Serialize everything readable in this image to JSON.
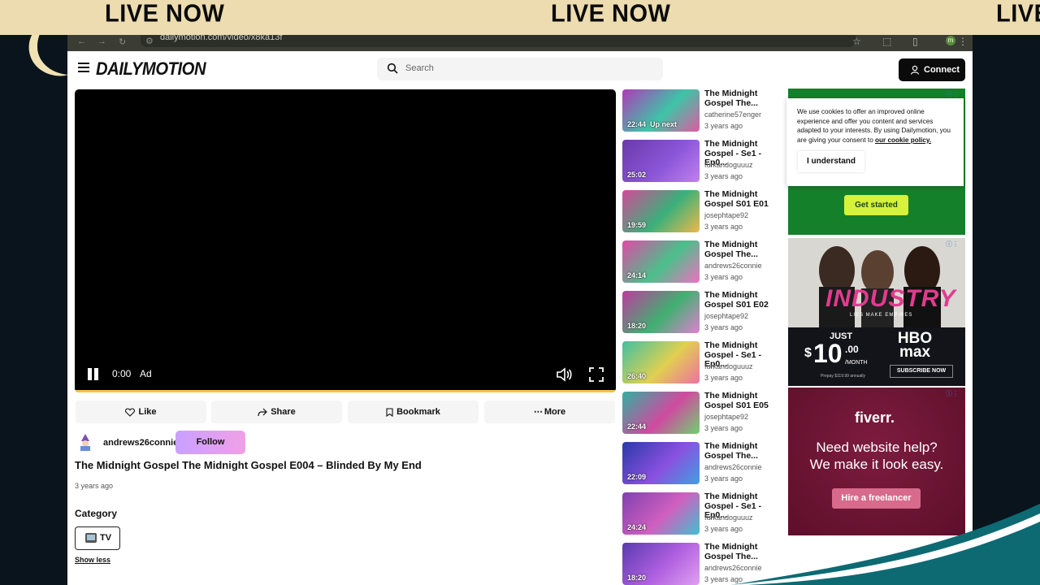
{
  "banner": {
    "text_1": "LIVE NOW",
    "text_2": "LIVE NOW",
    "text_3": "LIVE"
  },
  "browser": {
    "url": "dailymotion.com/video/x8ka13f",
    "profile_initial": "m"
  },
  "header": {
    "logo": "DAILYMOTION",
    "search_placeholder": "Search",
    "connect_label": "Connect"
  },
  "player": {
    "time": "0:00",
    "ad_label": "Ad",
    "progress": 1.0
  },
  "actions": {
    "like": "Like",
    "share": "Share",
    "bookmark": "Bookmark",
    "more": "More"
  },
  "channel": {
    "name": "andrews26connie",
    "follow_label": "Follow"
  },
  "video": {
    "title": "The Midnight Gospel The Midnight Gospel E004 – Blinded By My End",
    "date": "3 years ago",
    "category_heading": "Category",
    "category": "TV",
    "show_less": "Show less"
  },
  "related": [
    {
      "title": "The Midnight Gospel The...",
      "channel": "catherine57enger",
      "date": "3 years ago",
      "duration": "22:44",
      "badge": "Up next",
      "colors": [
        "#b03ab8",
        "#3ec4a8",
        "#e05aa0"
      ]
    },
    {
      "title": "The Midnight Gospel - Se1 - Ep0...",
      "channel": "furkandoguuuz",
      "date": "3 years ago",
      "duration": "25:02",
      "badge": "",
      "colors": [
        "#6a3aa8",
        "#8a55d8",
        "#c080f0"
      ]
    },
    {
      "title": "The Midnight Gospel S01 E01",
      "channel": "josephtape92",
      "date": "3 years ago",
      "duration": "19:59",
      "badge": "",
      "colors": [
        "#d44a9a",
        "#3ab07a",
        "#f0b84a"
      ]
    },
    {
      "title": "The Midnight Gospel The...",
      "channel": "andrews26connie",
      "date": "3 years ago",
      "duration": "24:14",
      "badge": "",
      "colors": [
        "#e04aa8",
        "#4ac08a",
        "#f070c0"
      ]
    },
    {
      "title": "The Midnight Gospel S01 E02",
      "channel": "josephtape92",
      "date": "3 years ago",
      "duration": "18:20",
      "badge": "",
      "colors": [
        "#c03aa0",
        "#40b070",
        "#e080d0"
      ]
    },
    {
      "title": "The Midnight Gospel - Se1 - Ep0...",
      "channel": "furkandoguuuz",
      "date": "3 years ago",
      "duration": "26:40",
      "badge": "",
      "colors": [
        "#40c0a0",
        "#e0d050",
        "#f070a0"
      ]
    },
    {
      "title": "The Midnight Gospel S01 E05",
      "channel": "josephtape92",
      "date": "3 years ago",
      "duration": "22:44",
      "badge": "",
      "colors": [
        "#30b0a0",
        "#d04aa0",
        "#70d070"
      ]
    },
    {
      "title": "The Midnight Gospel The...",
      "channel": "andrews26connie",
      "date": "3 years ago",
      "duration": "22:09",
      "badge": "",
      "colors": [
        "#2a3aa8",
        "#8a50e0",
        "#40a0e0"
      ]
    },
    {
      "title": "The Midnight Gospel - Se1 - Ep0...",
      "channel": "furkandoguuuz",
      "date": "3 years ago",
      "duration": "24:24",
      "badge": "",
      "colors": [
        "#8040b0",
        "#d060c0",
        "#40c0d0"
      ]
    },
    {
      "title": "The Midnight Gospel The...",
      "channel": "andrews26connie",
      "date": "3 years ago",
      "duration": "18:20",
      "badge": "",
      "colors": [
        "#5a3ab0",
        "#b060e0",
        "#e0a0f0"
      ]
    }
  ],
  "ads": {
    "cookie_text_1": "We use cookies to offer an improved online experience and offer you content and services adapted to your interests. By using Dailymotion, you are giving your consent to ",
    "cookie_link": "our cookie policy.",
    "cookie_button": "I understand",
    "ad1_cta": "Get started",
    "hbo_title": "INDUSTRY",
    "hbo_tagline": "LIES MAKE EMPIRES",
    "hbo_just": "JUST",
    "hbo_currency": "$",
    "hbo_price": "10",
    "hbo_cents": ".00",
    "hbo_per": "/MONTH",
    "hbo_fine": "Prepay $119.99 annually",
    "hbo_brand": "HBO max",
    "hbo_sub": "SUBSCRIBE NOW",
    "fiverr_brand": "fiverr.",
    "fiverr_headline_1": "Need website help?",
    "fiverr_headline_2": "We make it look easy.",
    "fiverr_cta": "Hire a freelancer"
  },
  "colors": {
    "accent_follow": "#d8a6f5",
    "progress": "#f6c343",
    "banner_bg": "#ecdcaf"
  }
}
